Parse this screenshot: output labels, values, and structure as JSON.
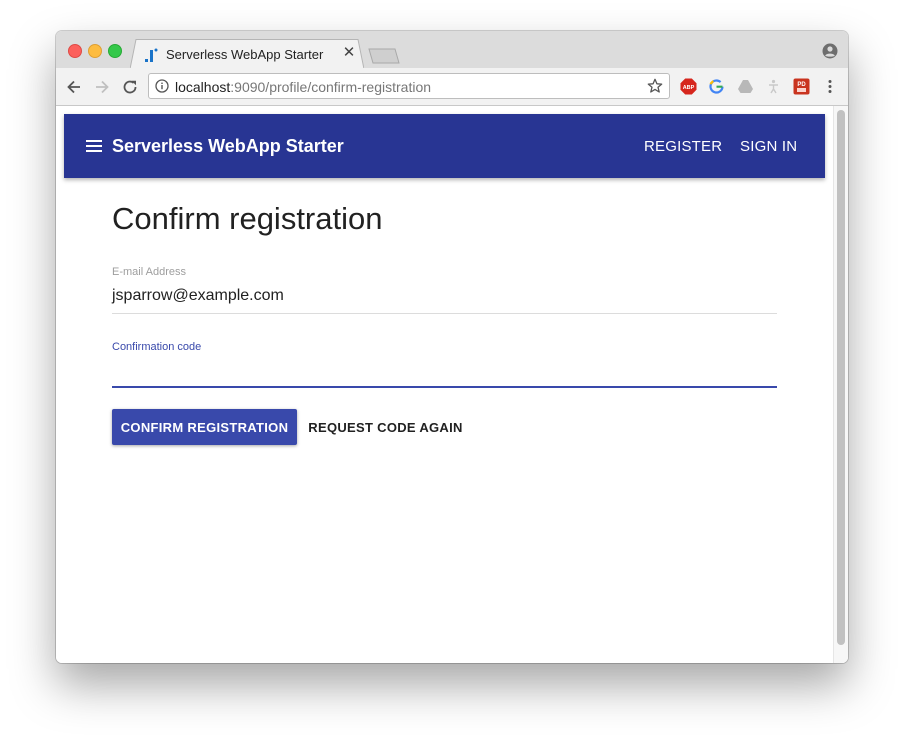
{
  "browser": {
    "tab_title": "Serverless WebApp Starter",
    "url_host": "localhost",
    "url_rest": ":9090/profile/confirm-registration",
    "extensions": [
      "adblock-icon",
      "google-icon",
      "drive-icon",
      "accessibility-icon",
      "pdf-icon"
    ]
  },
  "app": {
    "title": "Serverless WebApp Starter",
    "nav": {
      "register": "REGISTER",
      "sign_in": "SIGN IN"
    },
    "primary_color": "#283593",
    "accent_color": "#3949ab"
  },
  "page": {
    "title": "Confirm registration",
    "email": {
      "label": "E-mail Address",
      "value": "jsparrow@example.com"
    },
    "code": {
      "label": "Confirmation code",
      "value": ""
    },
    "confirm_button": "CONFIRM REGISTRATION",
    "request_button": "REQUEST CODE AGAIN"
  }
}
